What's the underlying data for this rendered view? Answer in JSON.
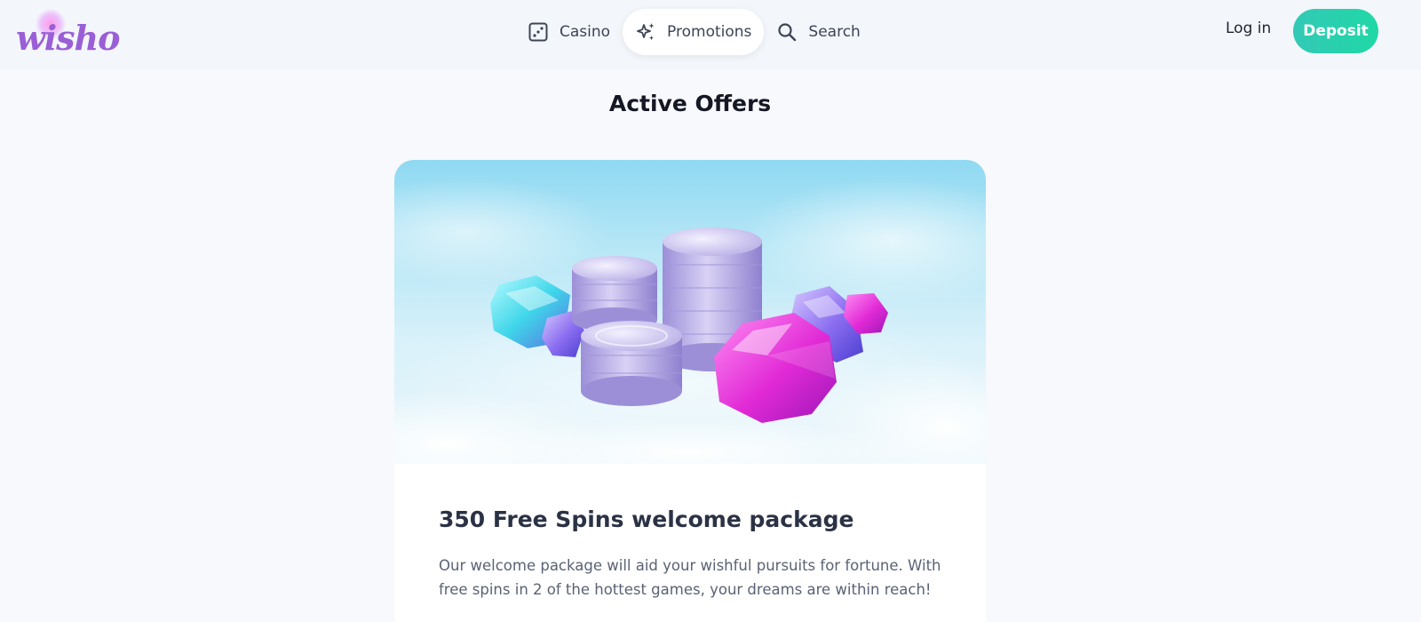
{
  "header": {
    "logo_text": "wisho",
    "nav": [
      {
        "label": "Casino",
        "icon": "dice-icon",
        "active": false
      },
      {
        "label": "Promotions",
        "icon": "sparkle-icon",
        "active": true
      },
      {
        "label": "Search",
        "icon": "search-icon",
        "active": false
      }
    ],
    "login_label": "Log in",
    "deposit_label": "Deposit"
  },
  "main": {
    "title": "Active Offers",
    "offer": {
      "image": "coins-and-gems-banner",
      "title": "350 Free Spins welcome package",
      "description": "Our welcome package will aid your wishful pursuits for fortune. With free spins in 2 of the hottest games, your dreams are within reach!"
    }
  },
  "colors": {
    "brand": "#9a5fd6",
    "deposit_start": "#33c9b6",
    "deposit_end": "#1fd8a6",
    "background": "#f7f9fc"
  }
}
